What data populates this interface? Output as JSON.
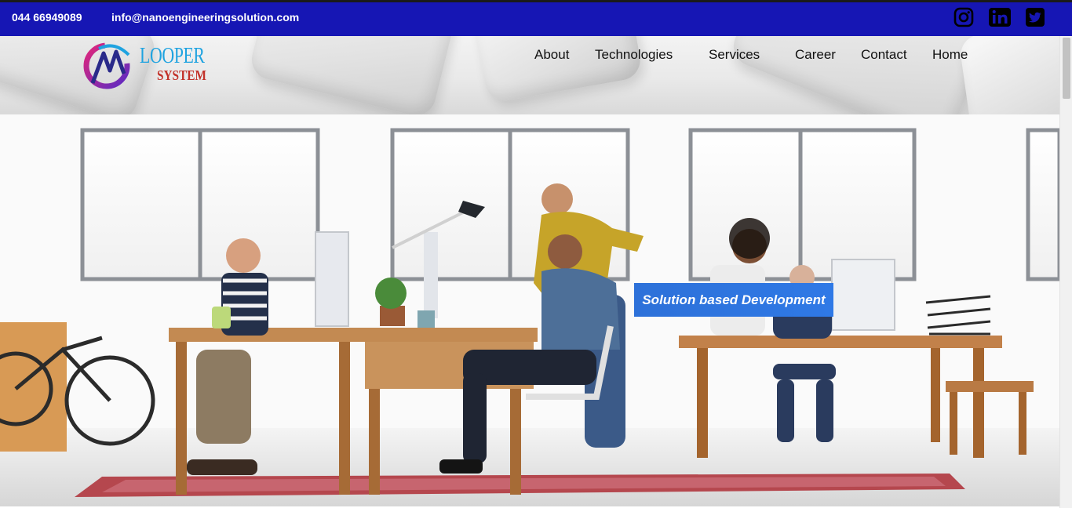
{
  "topbar": {
    "phone": "044 66949089",
    "email": "info@nanoengineeringsolution.com",
    "social": [
      "instagram-icon",
      "linkedin-icon",
      "twitter-icon"
    ],
    "background": "#1616b4"
  },
  "logo": {
    "line1": "LOOPER",
    "line2": "SYSTEM",
    "colors": {
      "gradient_start": "#e2267a",
      "gradient_end": "#5a2bc4",
      "accent": "#1fa3e0",
      "subtitle": "#c2322a"
    }
  },
  "nav": {
    "items": [
      {
        "label": "About",
        "dropdown": false
      },
      {
        "label": "Technologies",
        "dropdown": true
      },
      {
        "label": "Services",
        "dropdown": true
      },
      {
        "label": "Career",
        "dropdown": false
      },
      {
        "label": "Contact",
        "dropdown": false
      },
      {
        "label": "Home",
        "dropdown": false
      }
    ]
  },
  "hero": {
    "caption": "Solution based Development",
    "caption_color": "#2d71d9"
  }
}
